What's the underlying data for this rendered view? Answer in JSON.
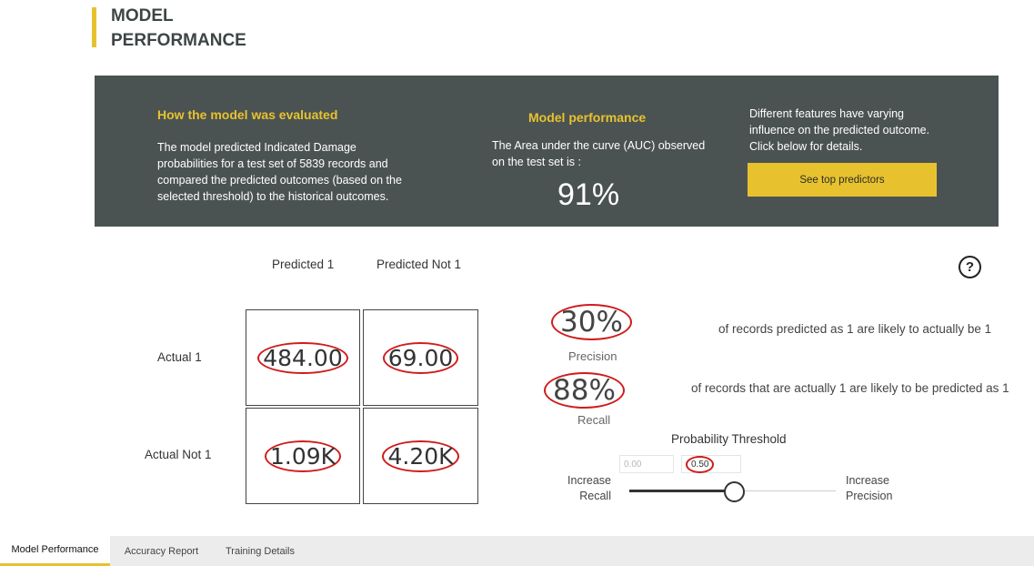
{
  "page": {
    "title_line1": "MODEL",
    "title_line2": "PERFORMANCE"
  },
  "banner": {
    "evaluated_heading": "How the model was evaluated",
    "evaluated_text": "The model predicted Indicated Damage probabilities for a test set of 5839 records and compared the predicted outcomes (based on the selected threshold) to the historical outcomes.",
    "performance_heading": "Model performance",
    "performance_text": "The Area under the curve (AUC) observed on the test set is :",
    "auc_value": "91%",
    "features_text": "Different features have varying influence on the predicted outcome.  Click below for details.",
    "predictors_button": "See top predictors"
  },
  "matrix": {
    "col_headers": [
      "Predicted 1",
      "Predicted Not 1"
    ],
    "row_headers": [
      "Actual 1",
      "Actual Not 1"
    ],
    "cells": [
      [
        "484.00",
        "69.00"
      ],
      [
        "1.09K",
        "4.20K"
      ]
    ]
  },
  "metrics": {
    "precision_value": "30%",
    "precision_label": "Precision",
    "precision_desc": "of records predicted as 1 are likely to actually be 1",
    "recall_value": "88%",
    "recall_label": "Recall",
    "recall_desc": "of records that are actually 1 are likely to be predicted as 1"
  },
  "threshold": {
    "title": "Probability Threshold",
    "min_value": "0.00",
    "current_value": "0.50",
    "slider_fraction": 0.5,
    "left_label_1": "Increase",
    "left_label_2": "Recall",
    "right_label_1": "Increase",
    "right_label_2": "Precision"
  },
  "help_icon": "question-circle-icon",
  "colors": {
    "accent": "#E8C22E",
    "banner_bg": "#4b5352",
    "highlight": "#d01c1c"
  },
  "tabs": [
    {
      "label": "Model Performance",
      "active": true
    },
    {
      "label": "Accuracy Report",
      "active": false
    },
    {
      "label": "Training Details",
      "active": false
    }
  ]
}
